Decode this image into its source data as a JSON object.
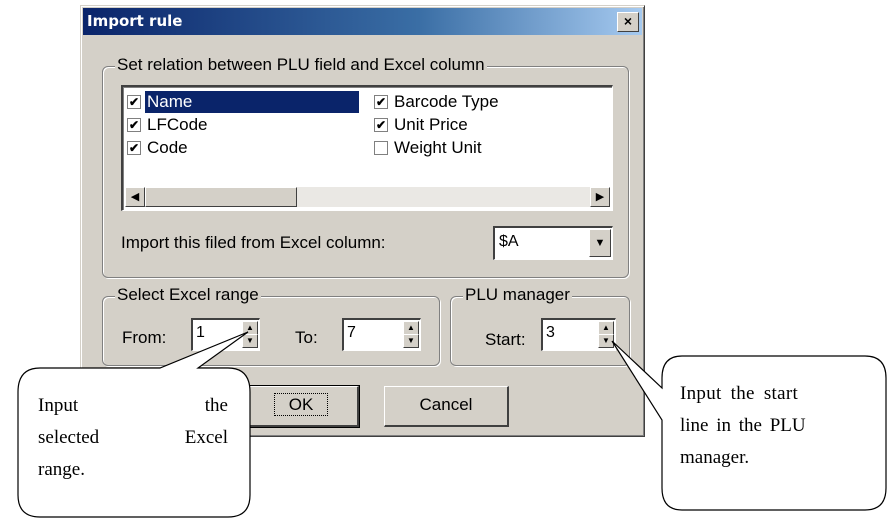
{
  "dialog": {
    "title": "Import rule",
    "close_label": "×"
  },
  "relation_group": {
    "title": "Set relation between PLU field and Excel column",
    "fields": [
      {
        "label": "Name",
        "checked": true,
        "selected": true
      },
      {
        "label": "LFCode",
        "checked": true,
        "selected": false
      },
      {
        "label": "Code",
        "checked": true,
        "selected": false
      },
      {
        "label": "Barcode Type",
        "checked": true,
        "selected": false
      },
      {
        "label": "Unit Price",
        "checked": true,
        "selected": false
      },
      {
        "label": "Weight Unit",
        "checked": false,
        "selected": false
      }
    ],
    "column_label": "Import this filed from Excel column:",
    "column_value": "$A"
  },
  "range_group": {
    "title": "Select Excel range",
    "from_label": "From:",
    "from_value": "1",
    "to_label": "To:",
    "to_value": "7"
  },
  "plu_group": {
    "title": "PLU manager",
    "start_label": "Start:",
    "start_value": "3"
  },
  "buttons": {
    "ok": "OK",
    "cancel": "Cancel"
  },
  "callouts": {
    "left": [
      "Input the",
      "selected Excel",
      "range."
    ],
    "right": [
      "Input the start",
      "line in the PLU",
      "manager."
    ]
  },
  "icons": {
    "check": "✔",
    "arrow_left": "◀",
    "arrow_right": "▶",
    "arrow_down": "▼",
    "arrow_up": "▲"
  }
}
